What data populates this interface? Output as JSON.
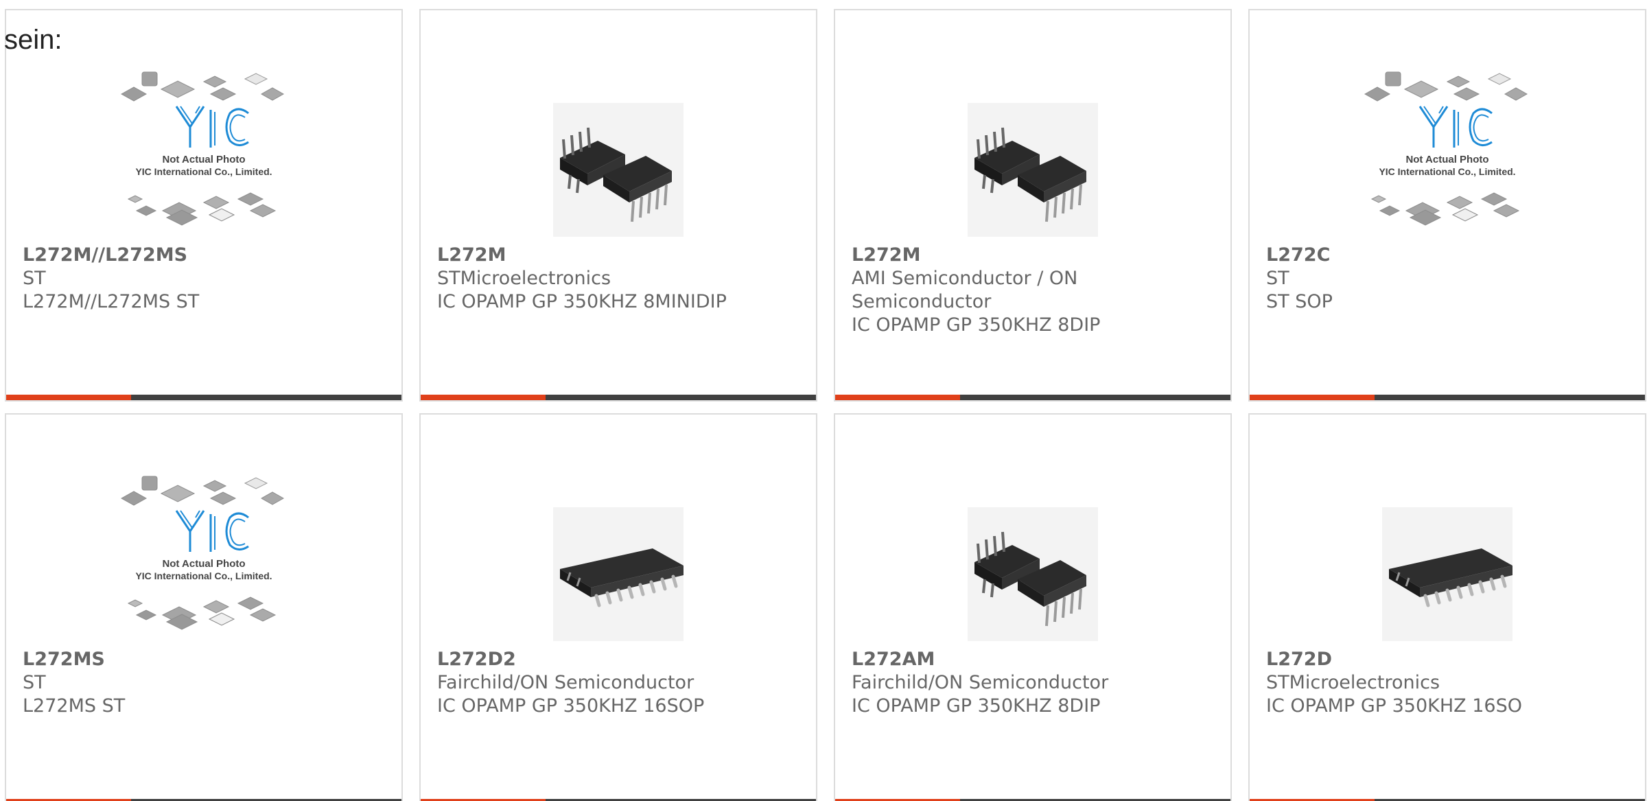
{
  "page": {
    "intro_text": "sein:"
  },
  "theme": {
    "accent_color": "#e0401a",
    "bar_color": "#404040",
    "text_color": "#666666",
    "logo_color": "#1e8bd6"
  },
  "products": [
    {
      "part_number": "L272M//L272MS",
      "manufacturer": "ST",
      "description": "L272M//L272MS ST",
      "image": "yic-placeholder",
      "placeholder_line1": "Not Actual Photo",
      "placeholder_line2": "YIC International Co., Limited.",
      "logo_text": "YIC"
    },
    {
      "part_number": "L272M",
      "manufacturer": "STMicroelectronics",
      "description": "IC OPAMP GP 350KHZ 8MINIDIP",
      "image": "dip8-chip"
    },
    {
      "part_number": "L272M",
      "manufacturer": "AMI Semiconductor / ON Semiconductor",
      "description": "IC OPAMP GP 350KHZ 8DIP",
      "image": "dip8-chip"
    },
    {
      "part_number": "L272C",
      "manufacturer": "ST",
      "description": "ST SOP",
      "image": "yic-placeholder",
      "placeholder_line1": "Not Actual Photo",
      "placeholder_line2": "YIC International Co., Limited.",
      "logo_text": "YIC"
    },
    {
      "part_number": "L272MS",
      "manufacturer": "ST",
      "description": "L272MS ST",
      "image": "yic-placeholder",
      "placeholder_line1": "Not Actual Photo",
      "placeholder_line2": "YIC International Co., Limited.",
      "logo_text": "YIC"
    },
    {
      "part_number": "L272D2",
      "manufacturer": "Fairchild/ON Semiconductor",
      "description": "IC OPAMP GP 350KHZ 16SOP",
      "image": "soic16-chip"
    },
    {
      "part_number": "L272AM",
      "manufacturer": "Fairchild/ON Semiconductor",
      "description": "IC OPAMP GP 350KHZ 8DIP",
      "image": "dip8-chip"
    },
    {
      "part_number": "L272D",
      "manufacturer": "STMicroelectronics",
      "description": "IC OPAMP GP 350KHZ 16SO",
      "image": "soic16-chip"
    }
  ]
}
